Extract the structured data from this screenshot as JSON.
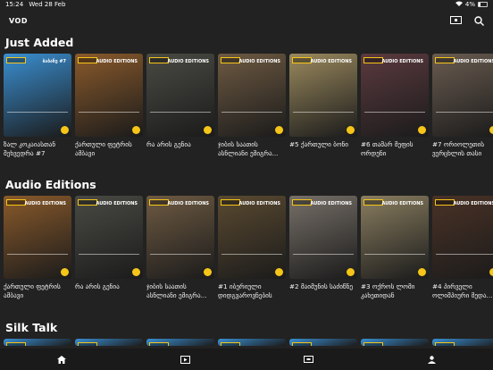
{
  "status": {
    "time": "15:24",
    "date": "Wed 28 Feb",
    "battery": "4%"
  },
  "header": {
    "title": "VOD",
    "cast_icon": "cast-icon",
    "search_icon": "search-icon"
  },
  "sections": [
    {
      "title": "Just Added",
      "items": [
        {
          "label": "ზალ კოკაიასთან შეხვედრა #7",
          "color": "#3a8fd1",
          "thumb_text": "ბაბანუ #7"
        },
        {
          "label": "ქართული ფეტრის ამბავი",
          "color": "#8a5a2b",
          "thumb_text": "AUDIO EDITIONS"
        },
        {
          "label": "რა არის გენია",
          "color": "#4a4a44",
          "thumb_text": "AUDIO EDITIONS"
        },
        {
          "label": "ჯიბის საათის ასნლიანი ემიგრა...",
          "color": "#6e5a42",
          "thumb_text": "AUDIO EDITIONS"
        },
        {
          "label": "#5 ქართული ბონი",
          "color": "#9b8a5e",
          "thumb_text": "AUDIO EDITIONS"
        },
        {
          "label": "#6 თამარ მეფის ორდენი",
          "color": "#5b3a3f",
          "thumb_text": "AUDIO EDITIONS"
        },
        {
          "label": "#7 ორიოლეთის ვერცხლის თასი",
          "color": "#6a5c50",
          "thumb_text": "AUDIO EDITIONS"
        }
      ]
    },
    {
      "title": "Audio Editions",
      "items": [
        {
          "label": "ქართული ფეტრის ამბავი",
          "color": "#8a5a2b",
          "thumb_text": "AUDIO EDITIONS"
        },
        {
          "label": "რა არის გენია",
          "color": "#4a4a44",
          "thumb_text": "AUDIO EDITIONS"
        },
        {
          "label": "ჯიბის საათის ასნლიანი ემიგრა...",
          "color": "#6e5a42",
          "thumb_text": "AUDIO EDITIONS"
        },
        {
          "label": "#1 იბერიული დიდგვაროვნების ქა...",
          "color": "#5a4a30",
          "thumb_text": "AUDIO EDITIONS"
        },
        {
          "label": "#2 მაიმუნის საძიწნე",
          "color": "#777068",
          "thumb_text": "AUDIO EDITIONS"
        },
        {
          "label": "#3 ოქროს ლომი კახეთიდან",
          "color": "#8a7e60",
          "thumb_text": "AUDIO EDITIONS"
        },
        {
          "label": "#4 პირველი ოლიმპიური მედა...",
          "color": "#4a3226",
          "thumb_text": "AUDIO EDITIONS"
        }
      ]
    },
    {
      "title": "Silk Talk",
      "items": [
        {
          "color": "#3a8fd1"
        },
        {
          "color": "#3a8fd1"
        },
        {
          "color": "#3a8fd1"
        },
        {
          "color": "#3a8fd1"
        },
        {
          "color": "#3a8fd1"
        },
        {
          "color": "#3a8fd1"
        },
        {
          "color": "#3a8fd1"
        }
      ]
    }
  ],
  "tabs": [
    {
      "name": "home-icon"
    },
    {
      "name": "video-icon"
    },
    {
      "name": "tv-icon"
    },
    {
      "name": "profile-icon"
    }
  ]
}
